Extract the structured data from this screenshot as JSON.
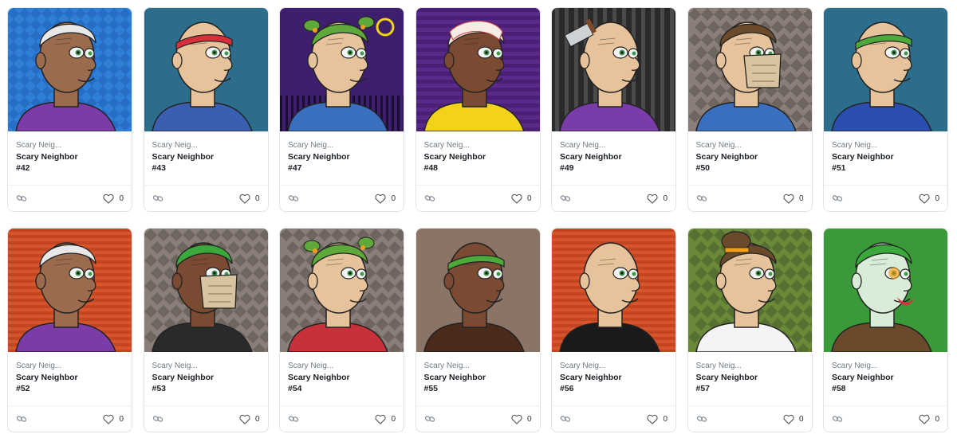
{
  "cards": [
    {
      "collection": "Scary Neig...",
      "name": "Scary Neighbor",
      "number": "#42",
      "likes": "0",
      "bg": "#2f7ed8",
      "bg2": "#1f64b8",
      "pattern": "diamond",
      "skin": "#9b6b4e",
      "hair": "#e8e8e8",
      "shirt": "#7b3ca8",
      "accessory": "none"
    },
    {
      "collection": "Scary Neig...",
      "name": "Scary Neighbor",
      "number": "#43",
      "likes": "0",
      "bg": "#2b6d8a",
      "bg2": "#235a73",
      "pattern": "plain",
      "skin": "#e7c39b",
      "hair": "#e7c39b",
      "shirt": "#3a5fb0",
      "accessory": "headband-red"
    },
    {
      "collection": "Scary Neig...",
      "name": "Scary Neighbor",
      "number": "#47",
      "likes": "0",
      "bg": "#3d1f6e",
      "bg2": "#2a1550",
      "pattern": "night",
      "skin": "#e7c39b",
      "hair": "#5fa83a",
      "shirt": "#3a6fc0",
      "accessory": "pigtails"
    },
    {
      "collection": "Scary Neig...",
      "name": "Scary Neighbor",
      "number": "#48",
      "likes": "0",
      "bg": "#5a2a8a",
      "bg2": "#4a1f75",
      "pattern": "stripes-v",
      "skin": "#7a4a32",
      "hair": "#f3e3d3",
      "shirt": "#f2d21b",
      "accessory": "bandage"
    },
    {
      "collection": "Scary Neig...",
      "name": "Scary Neighbor",
      "number": "#49",
      "likes": "0",
      "bg": "#2a2a2a",
      "bg2": "#4a4a4a",
      "pattern": "bars",
      "skin": "#e7c39b",
      "hair": "#e7c39b",
      "shirt": "#7a3ca8",
      "accessory": "cleaver"
    },
    {
      "collection": "Scary Neig...",
      "name": "Scary Neighbor",
      "number": "#50",
      "likes": "0",
      "bg": "#8a7f78",
      "bg2": "#6f655f",
      "pattern": "checker",
      "skin": "#e7c39b",
      "hair": "#6a4a2a",
      "shirt": "#3a6fc0",
      "accessory": "mask"
    },
    {
      "collection": "Scary Neig...",
      "name": "Scary Neighbor",
      "number": "#51",
      "likes": "0",
      "bg": "#2b6d8a",
      "bg2": "#235a73",
      "pattern": "plain",
      "skin": "#e7c39b",
      "hair": "#e7c39b",
      "shirt": "#2a4fb0",
      "accessory": "headband-green"
    },
    {
      "collection": "Scary Neig...",
      "name": "Scary Neighbor",
      "number": "#52",
      "likes": "0",
      "bg": "#d8542a",
      "bg2": "#b03a1a",
      "pattern": "stripes-h",
      "skin": "#9b6b4e",
      "hair": "#e8e8e8",
      "shirt": "#7b3ca8",
      "accessory": "none"
    },
    {
      "collection": "Scary Neig...",
      "name": "Scary Neighbor",
      "number": "#53",
      "likes": "0",
      "bg": "#8a7f78",
      "bg2": "#6f655f",
      "pattern": "checker",
      "skin": "#7a4a32",
      "hair": "#3aa83a",
      "shirt": "#2a2a2a",
      "accessory": "mask"
    },
    {
      "collection": "Scary Neig...",
      "name": "Scary Neighbor",
      "number": "#54",
      "likes": "0",
      "bg": "#8a7f78",
      "bg2": "#6f655f",
      "pattern": "checker",
      "skin": "#e7c39b",
      "hair": "#5fa83a",
      "shirt": "#c8303a",
      "accessory": "pigtails"
    },
    {
      "collection": "Scary Neig...",
      "name": "Scary Neighbor",
      "number": "#55",
      "likes": "0",
      "bg": "#8a7466",
      "bg2": "#7a6456",
      "pattern": "plain",
      "skin": "#7a4a32",
      "hair": "#7a4a32",
      "shirt": "#4a2a1a",
      "accessory": "headband-green"
    },
    {
      "collection": "Scary Neig...",
      "name": "Scary Neighbor",
      "number": "#56",
      "likes": "0",
      "bg": "#d8542a",
      "bg2": "#b03a1a",
      "pattern": "stripes-h",
      "skin": "#e7c39b",
      "hair": "#e7c39b",
      "shirt": "#1a1a1a",
      "accessory": "none"
    },
    {
      "collection": "Scary Neig...",
      "name": "Scary Neighbor",
      "number": "#57",
      "likes": "0",
      "bg": "#6a8a3a",
      "bg2": "#557030",
      "pattern": "checker-green",
      "skin": "#e7c39b",
      "hair": "#6a4a2a",
      "shirt": "#f4f4f4",
      "accessory": "bun"
    },
    {
      "collection": "Scary Neig...",
      "name": "Scary Neighbor",
      "number": "#58",
      "likes": "0",
      "bg": "#3a9a3a",
      "bg2": "#2e7e2e",
      "pattern": "plain",
      "skin": "#d8ecd8",
      "hair": "#3aa83a",
      "shirt": "#6a4a2a",
      "accessory": "joker"
    }
  ],
  "icons": {
    "chain": "link-icon",
    "heart": "heart-icon"
  }
}
